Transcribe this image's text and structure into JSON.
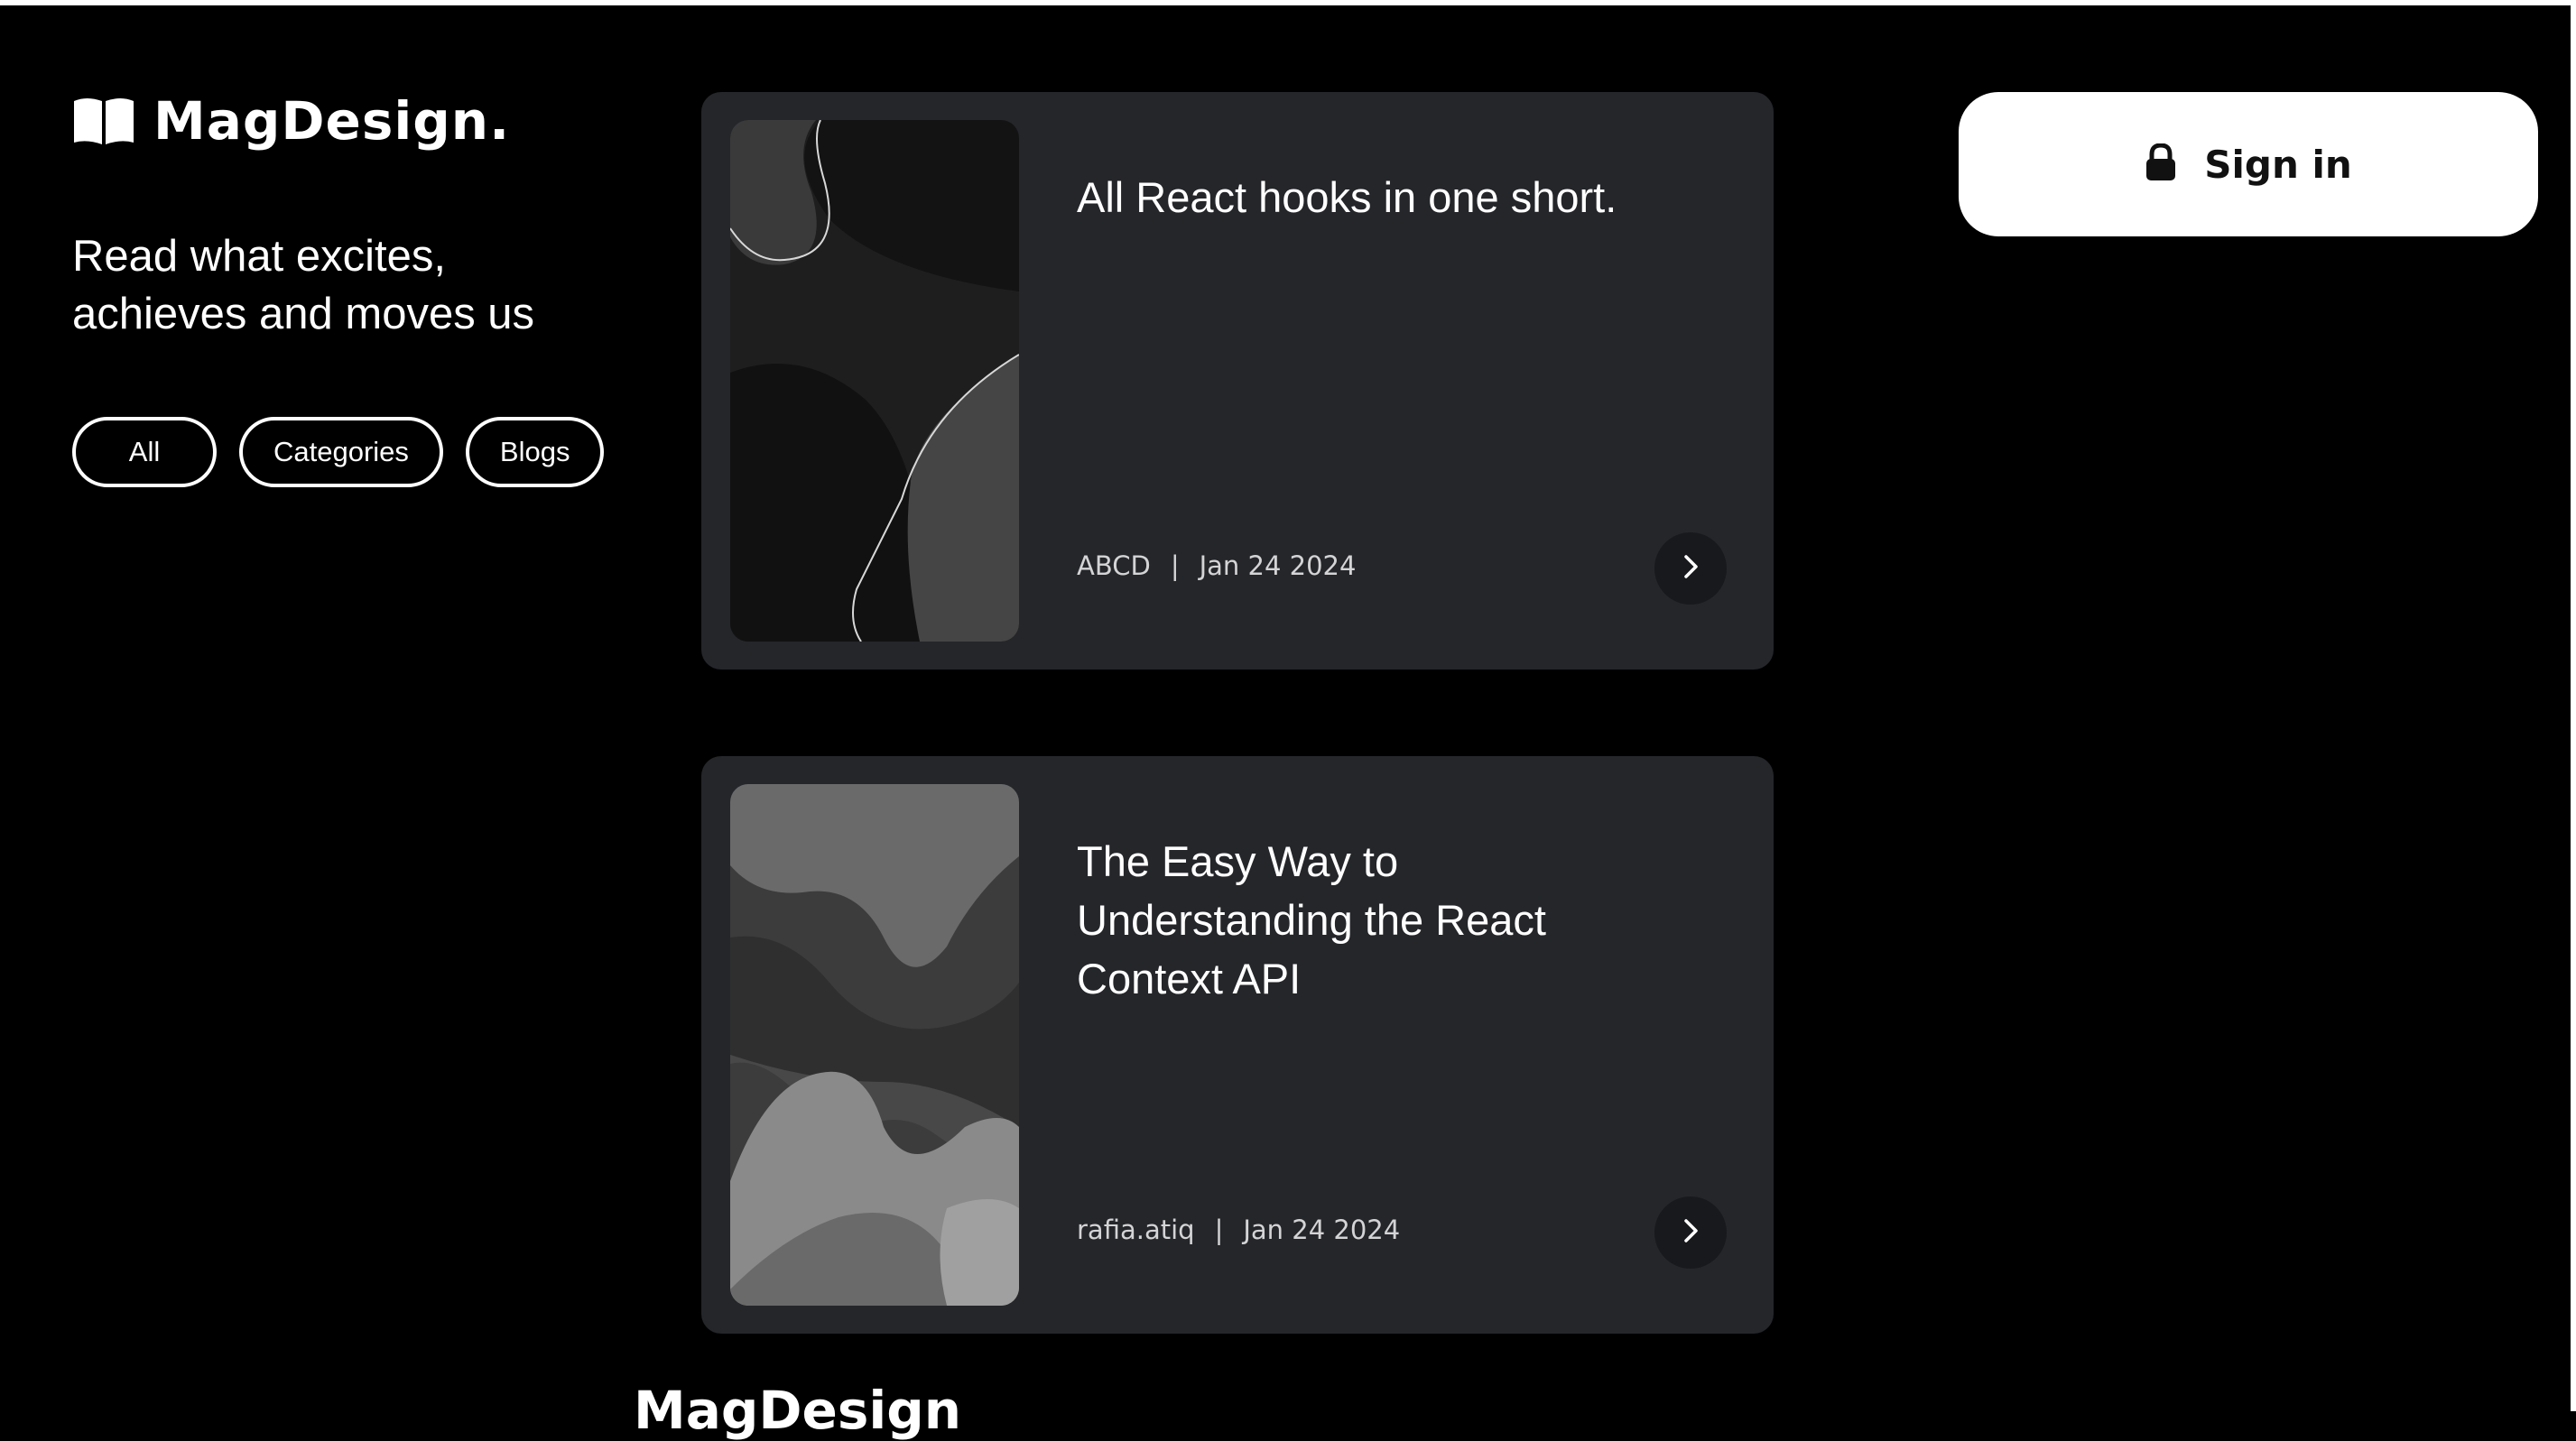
{
  "brand": {
    "name": "MagDesign.",
    "tagline": "Read what excites, achieves and moves us",
    "icon": "open-book-icon"
  },
  "filters": [
    {
      "label": "All"
    },
    {
      "label": "Categories"
    },
    {
      "label": "Blogs"
    }
  ],
  "posts": [
    {
      "title": "All React hooks in one short.",
      "author": "ABCD",
      "separator": "|",
      "date": "Jan 24 2024",
      "icon": "chevron-right-icon"
    },
    {
      "title": "The Easy Way to Understanding the React Context API",
      "author": "rafia.atiq",
      "separator": "|",
      "date": "Jan 24 2024",
      "icon": "chevron-right-icon"
    }
  ],
  "signin": {
    "label": "Sign in",
    "icon": "lock-icon"
  },
  "footer": {
    "brand": "MagDesign"
  },
  "colors": {
    "background": "#000000",
    "card": "#25262a",
    "button_bg": "#ffffff",
    "text": "#ffffff"
  }
}
